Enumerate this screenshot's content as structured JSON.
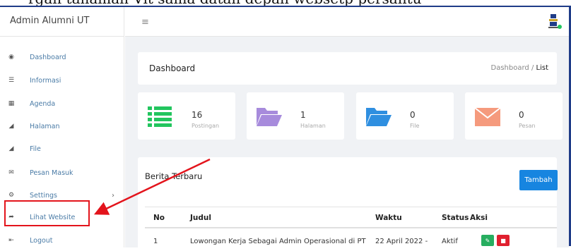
{
  "overlay_text": "rgan tanaman Vit sama datan depan websetp persantu",
  "app": {
    "title": "Admin Alumni UT"
  },
  "sidebar": {
    "items": [
      {
        "label": "Dashboard",
        "icon": "dashboard-icon"
      },
      {
        "label": "Informasi",
        "icon": "list-icon"
      },
      {
        "label": "Agenda",
        "icon": "calendar-icon"
      },
      {
        "label": "Halaman",
        "icon": "folder-icon"
      },
      {
        "label": "File",
        "icon": "folder-icon"
      },
      {
        "label": "Pesan Masuk",
        "icon": "envelope-icon"
      },
      {
        "label": "Settings",
        "icon": "gear-icon"
      },
      {
        "label": "Lihat Website",
        "icon": "share-icon"
      },
      {
        "label": "Logout",
        "icon": "logout-icon"
      }
    ]
  },
  "topbar": {
    "menu_icon": "hamburger-icon"
  },
  "dashboard": {
    "title": "Dashboard",
    "breadcrumb": {
      "parent": "Dashboard",
      "separator": "/",
      "current": "List"
    }
  },
  "stats": [
    {
      "value": "16",
      "label": "Postingan",
      "color": "#22c55e"
    },
    {
      "value": "1",
      "label": "Halaman",
      "color": "#a78bdc"
    },
    {
      "value": "0",
      "label": "File",
      "color": "#2f8fe0"
    },
    {
      "value": "0",
      "label": "Pesan",
      "color": "#f59a7d"
    }
  ],
  "news": {
    "title": "Berita Terbaru",
    "add_button": "Tambah",
    "columns": [
      "No",
      "Judul",
      "Waktu",
      "Status",
      "Aksi"
    ],
    "rows": [
      {
        "no": "1",
        "judul": "Lowongan Kerja Sebagai Admin Operasional di PT",
        "waktu": "22 April 2022 -",
        "status": "Aktif"
      }
    ]
  },
  "colors": {
    "accent": "#1785e0",
    "annotation": "#e3141c",
    "edit": "#27ae60",
    "delete": "#e0202f"
  }
}
